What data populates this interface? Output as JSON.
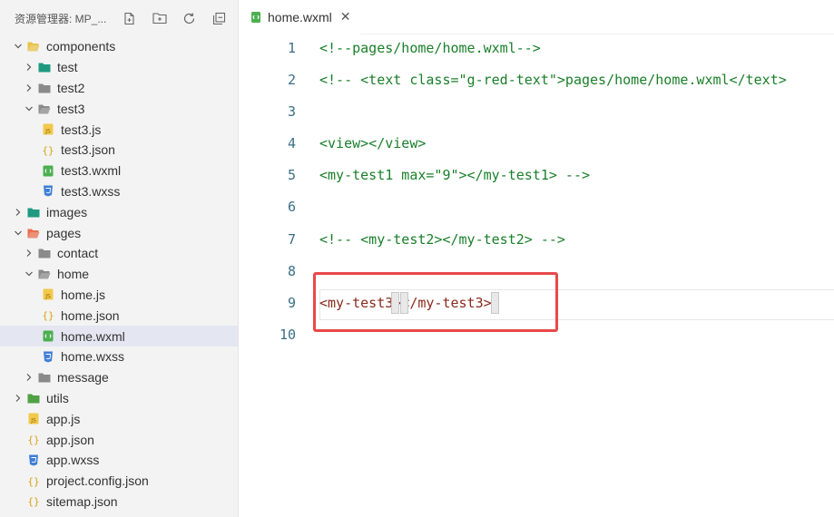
{
  "explorer": {
    "title": "资源管理器: MP_...",
    "tools": [
      {
        "name": "new-file-icon",
        "glyph": "new-file"
      },
      {
        "name": "new-folder-icon",
        "glyph": "new-folder"
      },
      {
        "name": "refresh-icon",
        "glyph": "refresh"
      },
      {
        "name": "collapse-all-icon",
        "glyph": "collapse"
      }
    ],
    "tree": [
      {
        "label": "components",
        "depth": 0,
        "type": "folder-open",
        "expanded": true,
        "color": "#e7c34b"
      },
      {
        "label": "test",
        "depth": 1,
        "type": "folder",
        "expanded": false,
        "color": "#1f9a80"
      },
      {
        "label": "test2",
        "depth": 1,
        "type": "folder",
        "expanded": false,
        "color": "#8a8a8a"
      },
      {
        "label": "test3",
        "depth": 1,
        "type": "folder-open",
        "expanded": true,
        "color": "#8a8a8a"
      },
      {
        "label": "test3.js",
        "depth": 2,
        "type": "js"
      },
      {
        "label": "test3.json",
        "depth": 2,
        "type": "json"
      },
      {
        "label": "test3.wxml",
        "depth": 2,
        "type": "wxml"
      },
      {
        "label": "test3.wxss",
        "depth": 2,
        "type": "wxss"
      },
      {
        "label": "images",
        "depth": 0,
        "type": "folder",
        "expanded": false,
        "color": "#1f9a80"
      },
      {
        "label": "pages",
        "depth": 0,
        "type": "folder-open",
        "expanded": true,
        "color": "#e8704f"
      },
      {
        "label": "contact",
        "depth": 1,
        "type": "folder",
        "expanded": false,
        "color": "#8a8a8a"
      },
      {
        "label": "home",
        "depth": 1,
        "type": "folder-open",
        "expanded": true,
        "color": "#8a8a8a"
      },
      {
        "label": "home.js",
        "depth": 2,
        "type": "js"
      },
      {
        "label": "home.json",
        "depth": 2,
        "type": "json"
      },
      {
        "label": "home.wxml",
        "depth": 2,
        "type": "wxml",
        "selected": true
      },
      {
        "label": "home.wxss",
        "depth": 2,
        "type": "wxss"
      },
      {
        "label": "message",
        "depth": 1,
        "type": "folder",
        "expanded": false,
        "color": "#8a8a8a"
      },
      {
        "label": "utils",
        "depth": 0,
        "type": "folder",
        "expanded": false,
        "color": "#52a046"
      },
      {
        "label": "app.js",
        "depth": 0,
        "type": "js",
        "leaf": true
      },
      {
        "label": "app.json",
        "depth": 0,
        "type": "json",
        "leaf": true
      },
      {
        "label": "app.wxss",
        "depth": 0,
        "type": "wxss",
        "leaf": true
      },
      {
        "label": "project.config.json",
        "depth": 0,
        "type": "json",
        "leaf": true
      },
      {
        "label": "sitemap.json",
        "depth": 0,
        "type": "json",
        "leaf": true
      }
    ]
  },
  "editor": {
    "tab": {
      "label": "home.wxml",
      "close": "✕"
    },
    "lines": [
      {
        "num": "1",
        "text": "<!--pages/home/home.wxml-->",
        "style": "comment"
      },
      {
        "num": "2",
        "text": "<!-- <text class=\"g-red-text\">pages/home/home.wxml</text>",
        "style": "comment"
      },
      {
        "num": "3",
        "text": "",
        "style": "comment"
      },
      {
        "num": "4",
        "text": "<view></view>",
        "style": "comment"
      },
      {
        "num": "5",
        "text": "<my-test1 max=\"9\"></my-test1> -->",
        "style": "comment"
      },
      {
        "num": "6",
        "text": "",
        "style": "comment"
      },
      {
        "num": "7",
        "text": "<!-- <my-test2></my-test2> -->",
        "style": "comment"
      },
      {
        "num": "8",
        "text": "",
        "style": "comment"
      },
      {
        "num": "9",
        "text": "<my-test3></my-test3>",
        "style": "tag"
      },
      {
        "num": "10",
        "text": "",
        "style": "comment"
      }
    ]
  },
  "colors": {
    "comment": "#1a7f2a",
    "tag": "#8a2a1c",
    "line_number": "#3a6f86",
    "highlight_box": "#e8494b",
    "selected_row": "#e4e6f1"
  }
}
